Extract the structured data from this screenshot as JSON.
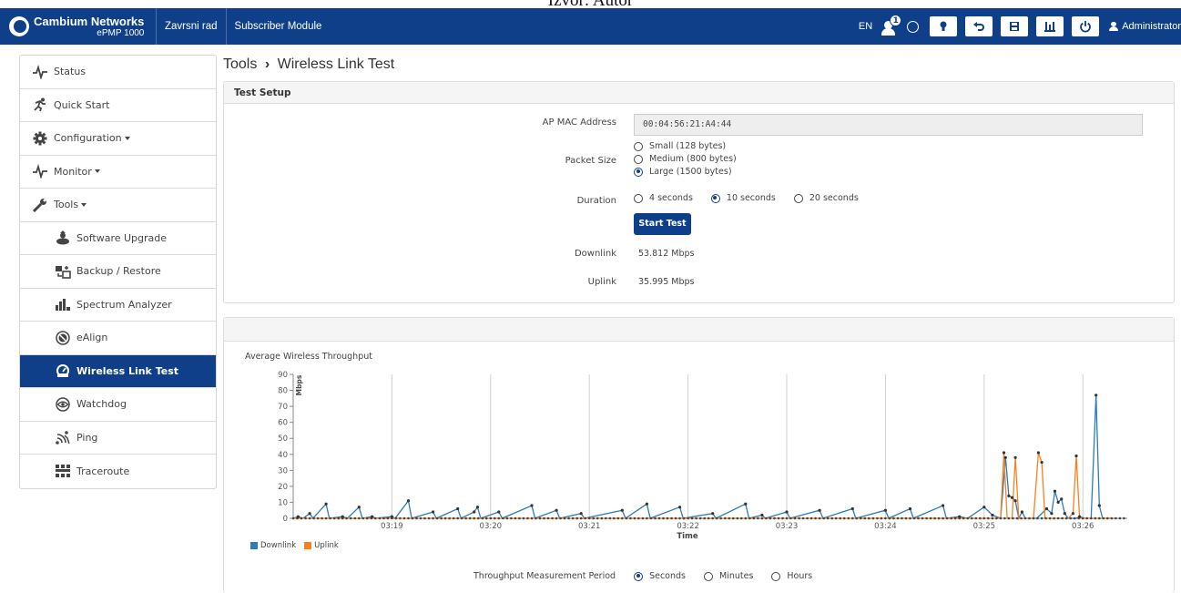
{
  "caption": "Izvor: Autor",
  "header": {
    "brand_name": "Cambium Networks",
    "brand_model": "ePMP 1000",
    "device_name": "Zavrsni rad",
    "mode": "Subscriber Module",
    "language": "EN",
    "notification_count": "1",
    "user": "Administrator"
  },
  "sidebar": {
    "items": [
      {
        "label": "Status",
        "icon": "pulse-icon"
      },
      {
        "label": "Quick Start",
        "icon": "runner-icon"
      },
      {
        "label": "Configuration",
        "icon": "gear-icon"
      },
      {
        "label": "Monitor",
        "icon": "pulse-icon"
      },
      {
        "label": "Tools",
        "icon": "wrench-icon"
      },
      {
        "label": "Software Upgrade",
        "icon": "upgrade-icon"
      },
      {
        "label": "Backup / Restore",
        "icon": "backup-icon"
      },
      {
        "label": "Spectrum Analyzer",
        "icon": "bars-icon"
      },
      {
        "label": "eAlign",
        "icon": "align-icon"
      },
      {
        "label": "Wireless Link Test",
        "icon": "speedometer-icon"
      },
      {
        "label": "Watchdog",
        "icon": "eye-icon"
      },
      {
        "label": "Ping",
        "icon": "ping-icon"
      },
      {
        "label": "Traceroute",
        "icon": "network-icon"
      }
    ]
  },
  "page": {
    "section": "Tools",
    "title": "Wireless Link Test"
  },
  "setup": {
    "heading": "Test Setup",
    "ap_mac_label": "AP MAC Address",
    "ap_mac_value": "00:04:56:21:A4:44",
    "packet_size_label": "Packet Size",
    "packet_sizes": [
      "Small (128 bytes)",
      "Medium (800 bytes)",
      "Large (1500 bytes)"
    ],
    "packet_size_selected": "Large (1500 bytes)",
    "duration_label": "Duration",
    "durations": [
      "4 seconds",
      "10 seconds",
      "20 seconds"
    ],
    "duration_selected": "10 seconds",
    "start_button": "Start Test",
    "downlink_label": "Downlink",
    "downlink_value": "53.812 Mbps",
    "uplink_label": "Uplink",
    "uplink_value": "35.995 Mbps"
  },
  "throughput": {
    "title": "Average Wireless Throughput",
    "period_label": "Throughput Measurement Period",
    "periods": [
      "Seconds",
      "Minutes",
      "Hours"
    ],
    "period_selected": "Seconds"
  },
  "colors": {
    "brand": "#0f3f88",
    "downlink": "#2a7bbf",
    "uplink": "#f5821f"
  },
  "chart_data": {
    "type": "line",
    "title": "Average Wireless Throughput",
    "xlabel": "Time",
    "ylabel": "Mbps",
    "ylim": [
      0,
      90
    ],
    "yticks": [
      0,
      10,
      20,
      30,
      40,
      50,
      60,
      70,
      80,
      90
    ],
    "xticks": [
      "03:19",
      "03:20",
      "03:21",
      "03:22",
      "03:23",
      "03:24",
      "03:25",
      "03:26"
    ],
    "xlim": [
      0,
      507
    ],
    "xtick_seconds": [
      60,
      120,
      180,
      240,
      300,
      360,
      420,
      480
    ],
    "grid": "vertical",
    "legend": "bottom-left",
    "series": [
      {
        "name": "Downlink",
        "points": [
          [
            0,
            0
          ],
          [
            3,
            1
          ],
          [
            6,
            0
          ],
          [
            10,
            3
          ],
          [
            12,
            0
          ],
          [
            20,
            9
          ],
          [
            22,
            0
          ],
          [
            30,
            1
          ],
          [
            33,
            0
          ],
          [
            40,
            7
          ],
          [
            42,
            0
          ],
          [
            48,
            1
          ],
          [
            50,
            0
          ],
          [
            60,
            1
          ],
          [
            62,
            0
          ],
          [
            70,
            11
          ],
          [
            72,
            0
          ],
          [
            85,
            4
          ],
          [
            87,
            0
          ],
          [
            100,
            6
          ],
          [
            102,
            0
          ],
          [
            110,
            4
          ],
          [
            112,
            7
          ],
          [
            114,
            0
          ],
          [
            125,
            4
          ],
          [
            127,
            0
          ],
          [
            145,
            8
          ],
          [
            147,
            0
          ],
          [
            160,
            5
          ],
          [
            162,
            0
          ],
          [
            175,
            3
          ],
          [
            177,
            0
          ],
          [
            200,
            5
          ],
          [
            202,
            0
          ],
          [
            215,
            9
          ],
          [
            217,
            0
          ],
          [
            235,
            7
          ],
          [
            237,
            0
          ],
          [
            255,
            3
          ],
          [
            257,
            0
          ],
          [
            275,
            9
          ],
          [
            277,
            0
          ],
          [
            285,
            2
          ],
          [
            287,
            0
          ],
          [
            300,
            4
          ],
          [
            302,
            0
          ],
          [
            320,
            5
          ],
          [
            322,
            0
          ],
          [
            340,
            6
          ],
          [
            342,
            0
          ],
          [
            360,
            5
          ],
          [
            362,
            0
          ],
          [
            375,
            6
          ],
          [
            377,
            0
          ],
          [
            395,
            8
          ],
          [
            397,
            0
          ],
          [
            405,
            1
          ],
          [
            410,
            0
          ],
          [
            420,
            7
          ],
          [
            425,
            2
          ],
          [
            430,
            0
          ],
          [
            433,
            38
          ],
          [
            435,
            14
          ],
          [
            437,
            13
          ],
          [
            439,
            11
          ],
          [
            441,
            0
          ],
          [
            443,
            4
          ],
          [
            445,
            0
          ],
          [
            452,
            0
          ],
          [
            458,
            6
          ],
          [
            461,
            3
          ],
          [
            463,
            17
          ],
          [
            465,
            10
          ],
          [
            467,
            12
          ],
          [
            469,
            3
          ],
          [
            471,
            0
          ],
          [
            476,
            0
          ],
          [
            478,
            1
          ],
          [
            481,
            0
          ],
          [
            485,
            0
          ],
          [
            488,
            77
          ],
          [
            490,
            8
          ],
          [
            492,
            0
          ],
          [
            500,
            0
          ]
        ]
      },
      {
        "name": "Uplink",
        "points": [
          [
            0,
            0
          ],
          [
            430,
            0
          ],
          [
            432,
            41
          ],
          [
            434,
            0
          ],
          [
            437,
            0
          ],
          [
            439,
            38
          ],
          [
            441,
            0
          ],
          [
            450,
            0
          ],
          [
            453,
            41
          ],
          [
            455,
            35
          ],
          [
            457,
            0
          ],
          [
            471,
            0
          ],
          [
            474,
            3
          ],
          [
            476,
            39
          ],
          [
            478,
            0
          ],
          [
            500,
            0
          ]
        ]
      }
    ]
  }
}
